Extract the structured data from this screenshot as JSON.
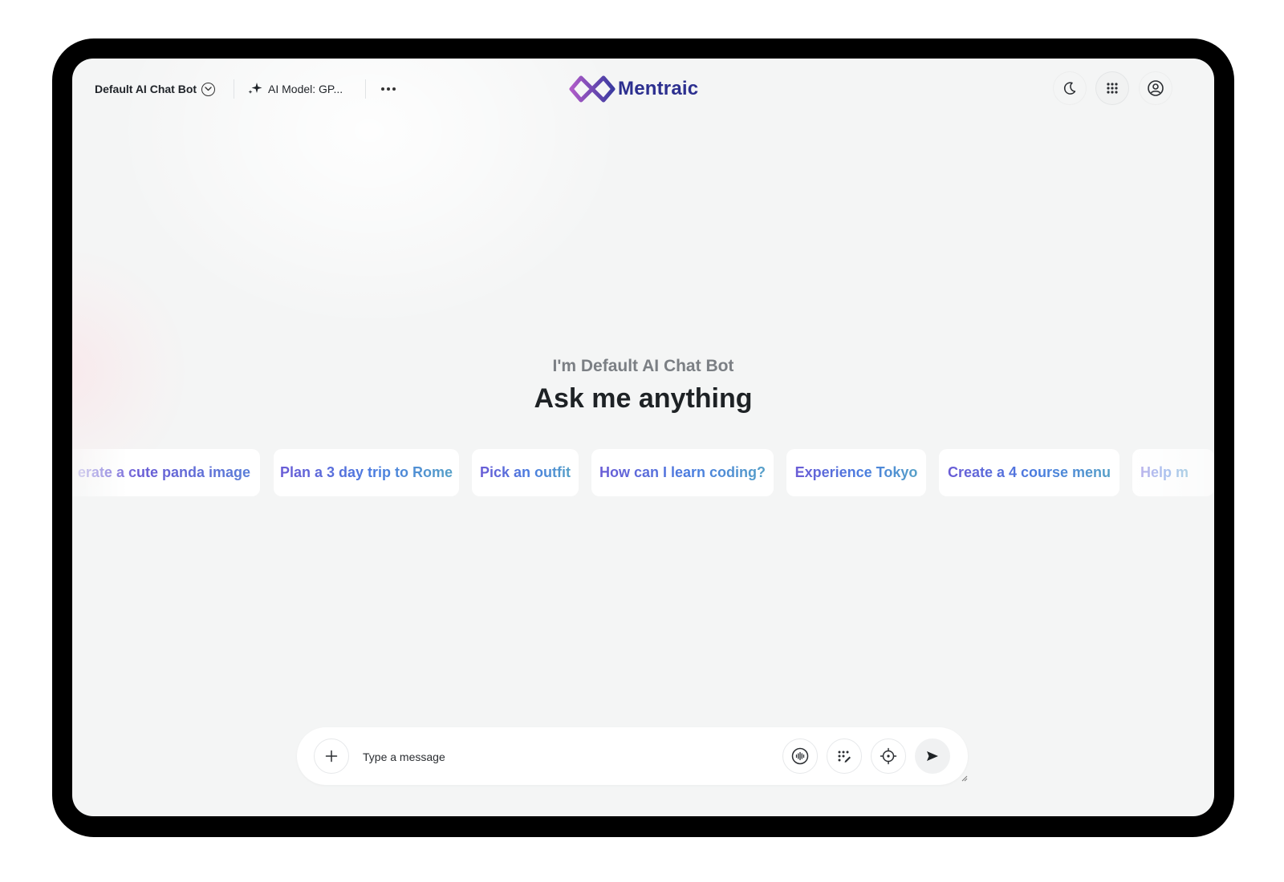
{
  "header": {
    "bot_selector_label": "Default AI Chat Bot",
    "model_selector_label": "AI Model: GP...",
    "brand": "Mentraic",
    "icons": {
      "bot_selector": "chevron-down-circle-icon",
      "model": "sparkle-icon",
      "more": "more-horizontal-icon",
      "theme": "moon-icon",
      "apps": "grid-icon",
      "profile": "user-circle-icon"
    }
  },
  "hero": {
    "subtitle": "I'm Default AI Chat Bot",
    "title": "Ask me anything"
  },
  "suggestions": [
    "erate a cute panda image",
    "Plan a 3 day trip to Rome",
    "Pick an outfit",
    "How can I learn coding?",
    "Experience Tokyo",
    "Create a 4 course menu",
    "Help m"
  ],
  "composer": {
    "placeholder": "Type a message",
    "icons": {
      "attach": "plus-icon",
      "voice": "audio-waveform-icon",
      "prompts": "magic-dots-icon",
      "target": "crosshair-icon",
      "send": "send-icon"
    }
  },
  "colors": {
    "brand_dark": "#2c2f8f",
    "brand_purple": "#8a4fc4",
    "chip_gradient_start": "#6a5cd6",
    "chip_gradient_end": "#56a0c8",
    "screen_bg": "#f4f5f5"
  }
}
